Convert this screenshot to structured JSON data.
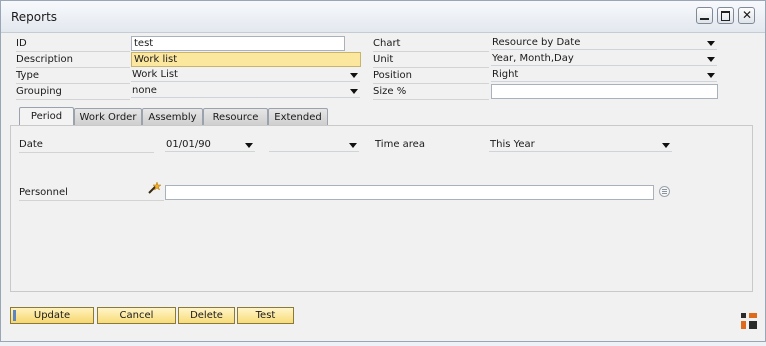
{
  "window": {
    "title": "Reports"
  },
  "form": {
    "id_label": "ID",
    "id_value": "test",
    "description_label": "Description",
    "description_value": "Work list",
    "type_label": "Type",
    "type_value": "Work List",
    "grouping_label": "Grouping",
    "grouping_value": "none",
    "chart_label": "Chart",
    "chart_value": "Resource by Date",
    "unit_label": "Unit",
    "unit_value": "Year, Month,Day",
    "position_label": "Position",
    "position_value": "Right",
    "size_label": "Size %",
    "size_value": ""
  },
  "tabs": [
    "Period",
    "Work Order",
    "Assembly",
    "Resource",
    "Extended"
  ],
  "period": {
    "date_label": "Date",
    "date_from": "01/01/90",
    "date_to": "",
    "time_area_label": "Time area",
    "time_area_value": "This Year",
    "personnel_label": "Personnel",
    "personnel_value": ""
  },
  "buttons": {
    "update": "Update",
    "cancel": "Cancel",
    "delete": "Delete",
    "test": "Test"
  }
}
